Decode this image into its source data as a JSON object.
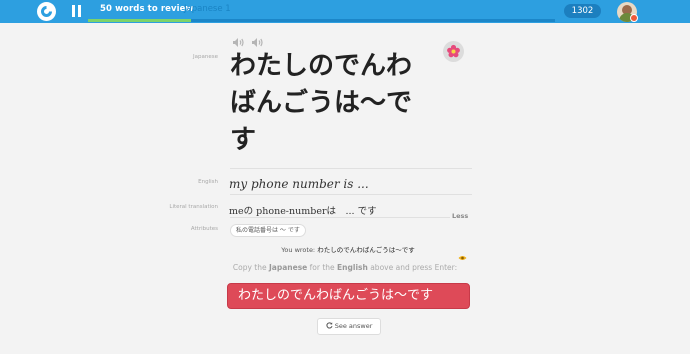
{
  "topbar": {
    "logo_icon": "memrise-logo-icon",
    "pause_icon": "pause-icon",
    "progress_title": "50 words to review",
    "progress_subtitle": "Japanese 1",
    "progress_fraction": 0.22,
    "score": "1302",
    "avatar_icon": "user-avatar",
    "accent_color": "#2d9fe0",
    "progress_color": "#7dd36a"
  },
  "card": {
    "labels": {
      "japanese": "Japanese",
      "english": "English",
      "literal": "Literal translation",
      "attributes": "Attributes"
    },
    "audio_icons": [
      "speaker-slow-icon",
      "speaker-normal-icon"
    ],
    "japanese_text": "わたしのでんわばんごうは〜です",
    "flower_icon": "flower-mem-icon",
    "english_text": "my phone number is ...",
    "literal_text": "meの phone-numberは　... です",
    "less_label": "Less",
    "attribute_tag": "私の電話番号は 〜 です",
    "you_wrote_prefix": "You wrote: ",
    "you_wrote_value": "わたしのでんわばんごうは〜です",
    "eye_icon": "eye-icon"
  },
  "instruction": {
    "part1": "Copy the ",
    "lang1": "Japanese",
    "part2": " for the ",
    "lang2": "English",
    "part3": " above and press Enter:"
  },
  "answer": {
    "value": "わたしのでんわばんごうは〜です",
    "color": "#de4a58"
  },
  "see_answer": {
    "label": "See answer",
    "icon": "refresh-icon"
  }
}
